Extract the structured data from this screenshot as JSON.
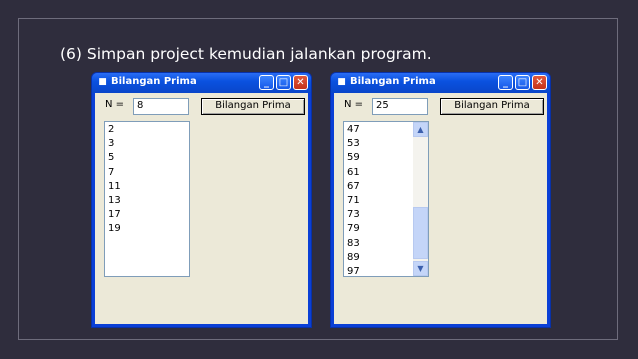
{
  "slide": {
    "heading": "(6) Simpan project kemudian jalankan program."
  },
  "windows": [
    {
      "title": "Bilangan Prima",
      "n_label": "N =",
      "n_value": "8",
      "button_label": "Bilangan Prima",
      "list_items": [
        "2",
        "3",
        "5",
        "7",
        "11",
        "13",
        "17",
        "19"
      ],
      "has_scrollbar": false
    },
    {
      "title": "Bilangan Prima",
      "n_label": "N =",
      "n_value": "25",
      "button_label": "Bilangan Prima",
      "list_items": [
        "47",
        "53",
        "59",
        "61",
        "67",
        "71",
        "73",
        "79",
        "83",
        "89",
        "97"
      ],
      "has_scrollbar": true
    }
  ],
  "icons": {
    "title_icon": "app-icon",
    "minimize": "minimize-icon",
    "maximize": "maximize-icon",
    "close": "close-icon",
    "scroll_up": "scroll-up-arrow-icon",
    "scroll_down": "scroll-down-arrow-icon"
  },
  "colors": {
    "slide_background": "#2f2d3d",
    "titlebar": "#0b52e0",
    "window_face": "#ece9d8",
    "close_button": "#c4331a"
  }
}
